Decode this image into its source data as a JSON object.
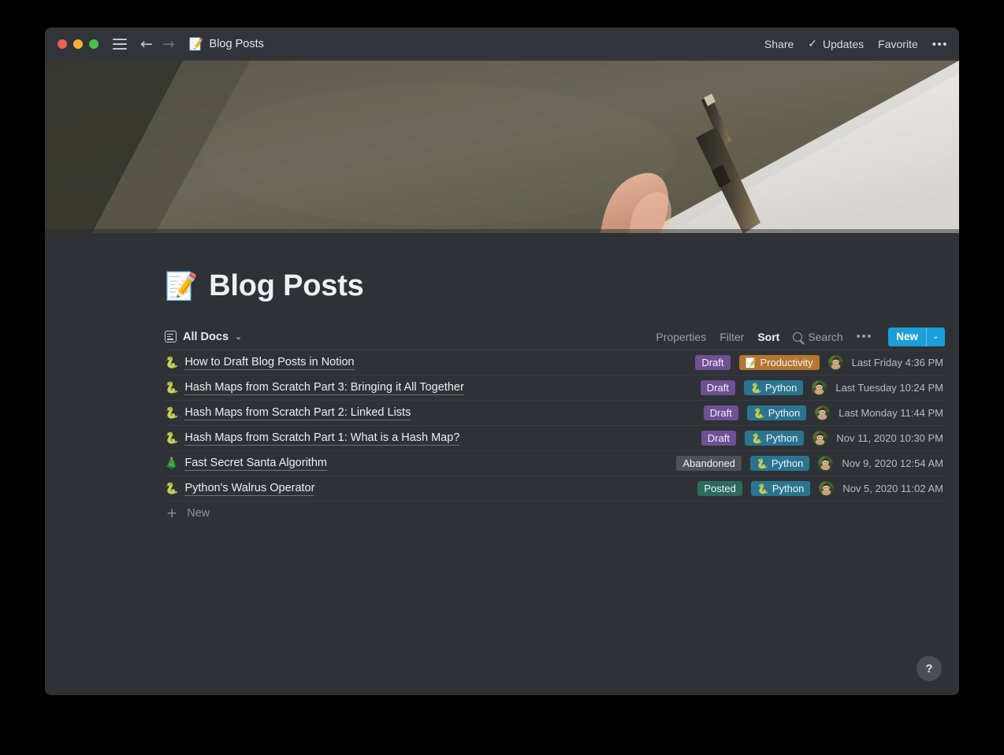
{
  "window": {
    "titlebar": {
      "traffic_lights": [
        "close",
        "minimize",
        "maximize"
      ],
      "menu_icon": "hamburger-icon",
      "back_arrow": "←",
      "forward_arrow": "→",
      "breadcrumb_emoji": "📝",
      "breadcrumb_title": "Blog Posts",
      "share_label": "Share",
      "updates_check": "✓",
      "updates_label": "Updates",
      "favorite_label": "Favorite",
      "more_label": "•••"
    }
  },
  "page": {
    "title_emoji": "📝",
    "title": "Blog Posts"
  },
  "database": {
    "view_name": "All Docs",
    "view_chevron": "⌄",
    "actions": {
      "properties": "Properties",
      "filter": "Filter",
      "sort": "Sort",
      "search": "Search",
      "more": "•••",
      "new": "New",
      "new_chevron": "⌄"
    },
    "accent_color": "#1a9fd9",
    "add_row_label": "New",
    "add_row_icon": "+",
    "tag_colors": {
      "draft": "#6f4f96",
      "abandoned": "#4e5257",
      "posted": "#2d6b5b",
      "productivity": "#b5762f",
      "python": "#2a7490"
    },
    "rows": [
      {
        "emoji": "🐍",
        "title": "How to Draft Blog Posts in Notion",
        "status": "Draft",
        "status_color": "#6f4f96",
        "tag_emoji": "📝",
        "tag": "Productivity",
        "tag_color": "#b5762f",
        "date": "Last Friday 4:36 PM"
      },
      {
        "emoji": "🐍",
        "title": "Hash Maps from Scratch Part 3: Bringing it All Together",
        "status": "Draft",
        "status_color": "#6f4f96",
        "tag_emoji": "🐍",
        "tag": "Python",
        "tag_color": "#2a7490",
        "date": "Last Tuesday 10:24 PM"
      },
      {
        "emoji": "🐍",
        "title": "Hash Maps from Scratch Part 2: Linked Lists",
        "status": "Draft",
        "status_color": "#6f4f96",
        "tag_emoji": "🐍",
        "tag": "Python",
        "tag_color": "#2a7490",
        "date": "Last Monday 11:44 PM"
      },
      {
        "emoji": "🐍",
        "title": "Hash Maps from Scratch Part 1: What is a Hash Map?",
        "status": "Draft",
        "status_color": "#6f4f96",
        "tag_emoji": "🐍",
        "tag": "Python",
        "tag_color": "#2a7490",
        "date": "Nov 11, 2020 10:30 PM"
      },
      {
        "emoji": "🎄",
        "title": "Fast Secret Santa Algorithm",
        "status": "Abandoned",
        "status_color": "#4e5257",
        "tag_emoji": "🐍",
        "tag": "Python",
        "tag_color": "#2a7490",
        "date": "Nov 9, 2020 12:54 AM"
      },
      {
        "emoji": "🐍",
        "title": "Python's Walrus Operator",
        "status": "Posted",
        "status_color": "#2d6b5b",
        "tag_emoji": "🐍",
        "tag": "Python",
        "tag_color": "#2a7490",
        "date": "Nov 5, 2020 11:02 AM"
      }
    ]
  },
  "help": {
    "label": "?"
  }
}
